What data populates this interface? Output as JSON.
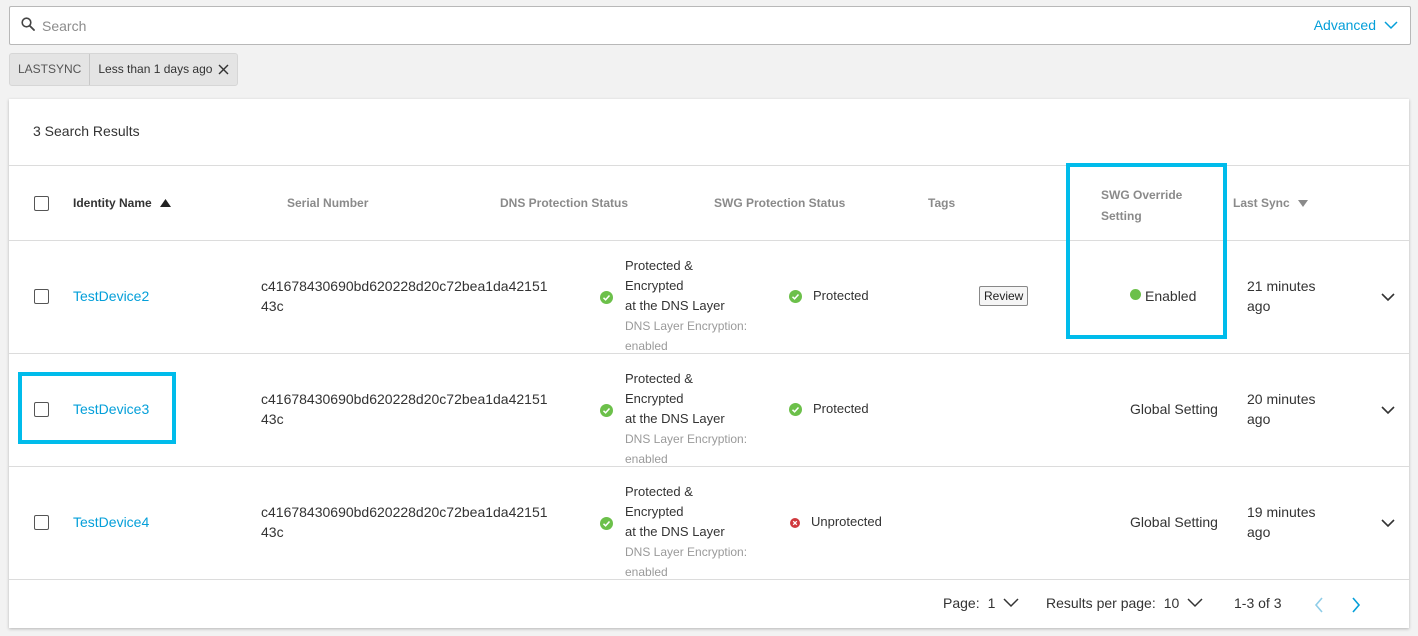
{
  "search": {
    "placeholder": "Search",
    "advanced_label": "Advanced"
  },
  "filter": {
    "key": "LASTSYNC",
    "value": "Less than 1 days ago"
  },
  "results_summary": "3 Search Results",
  "columns": {
    "identity_name": "Identity Name",
    "serial_number": "Serial Number",
    "dns_status": "DNS Protection Status",
    "swg_status": "SWG Protection Status",
    "tags": "Tags",
    "swg_override_line1": "SWG Override",
    "swg_override_line2": "Setting",
    "last_sync": "Last Sync"
  },
  "rows": [
    {
      "identity": "TestDevice2",
      "serial_line1": "c41678430690bd620228d20c72bea1da42151",
      "serial_line2": "43c",
      "dns_line1": "Protected & Encrypted",
      "dns_line2": "at the DNS Layer",
      "dns_sub1": "DNS Layer Encryption:",
      "dns_sub2": "enabled",
      "swg_status": "Protected",
      "swg_status_color": "#6cc04a",
      "tag": "Review",
      "override": "Enabled",
      "sync_line1": "21 minutes",
      "sync_line2": "ago"
    },
    {
      "identity": "TestDevice3",
      "serial_line1": "c41678430690bd620228d20c72bea1da42151",
      "serial_line2": "43c",
      "dns_line1": "Protected & Encrypted",
      "dns_line2": "at the DNS Layer",
      "dns_sub1": "DNS Layer Encryption:",
      "dns_sub2": "enabled",
      "swg_status": "Protected",
      "swg_status_color": "#6cc04a",
      "tag": "",
      "override": "Global Setting",
      "sync_line1": "20 minutes",
      "sync_line2": "ago"
    },
    {
      "identity": "TestDevice4",
      "serial_line1": "c41678430690bd620228d20c72bea1da42151",
      "serial_line2": "43c",
      "dns_line1": "Protected & Encrypted",
      "dns_line2": "at the DNS Layer",
      "dns_sub1": "DNS Layer Encryption:",
      "dns_sub2": "enabled",
      "swg_status": "Unprotected",
      "swg_status_color": "#d0393e",
      "tag": "",
      "override": "Global Setting",
      "sync_line1": "19 minutes",
      "sync_line2": "ago"
    }
  ],
  "pagination": {
    "page_label": "Page:",
    "page_value": "1",
    "per_page_label": "Results per page:",
    "per_page_value": "10",
    "range": "1-3 of 3"
  },
  "colors": {
    "accent": "#049fd9",
    "highlight": "#00bceb"
  }
}
